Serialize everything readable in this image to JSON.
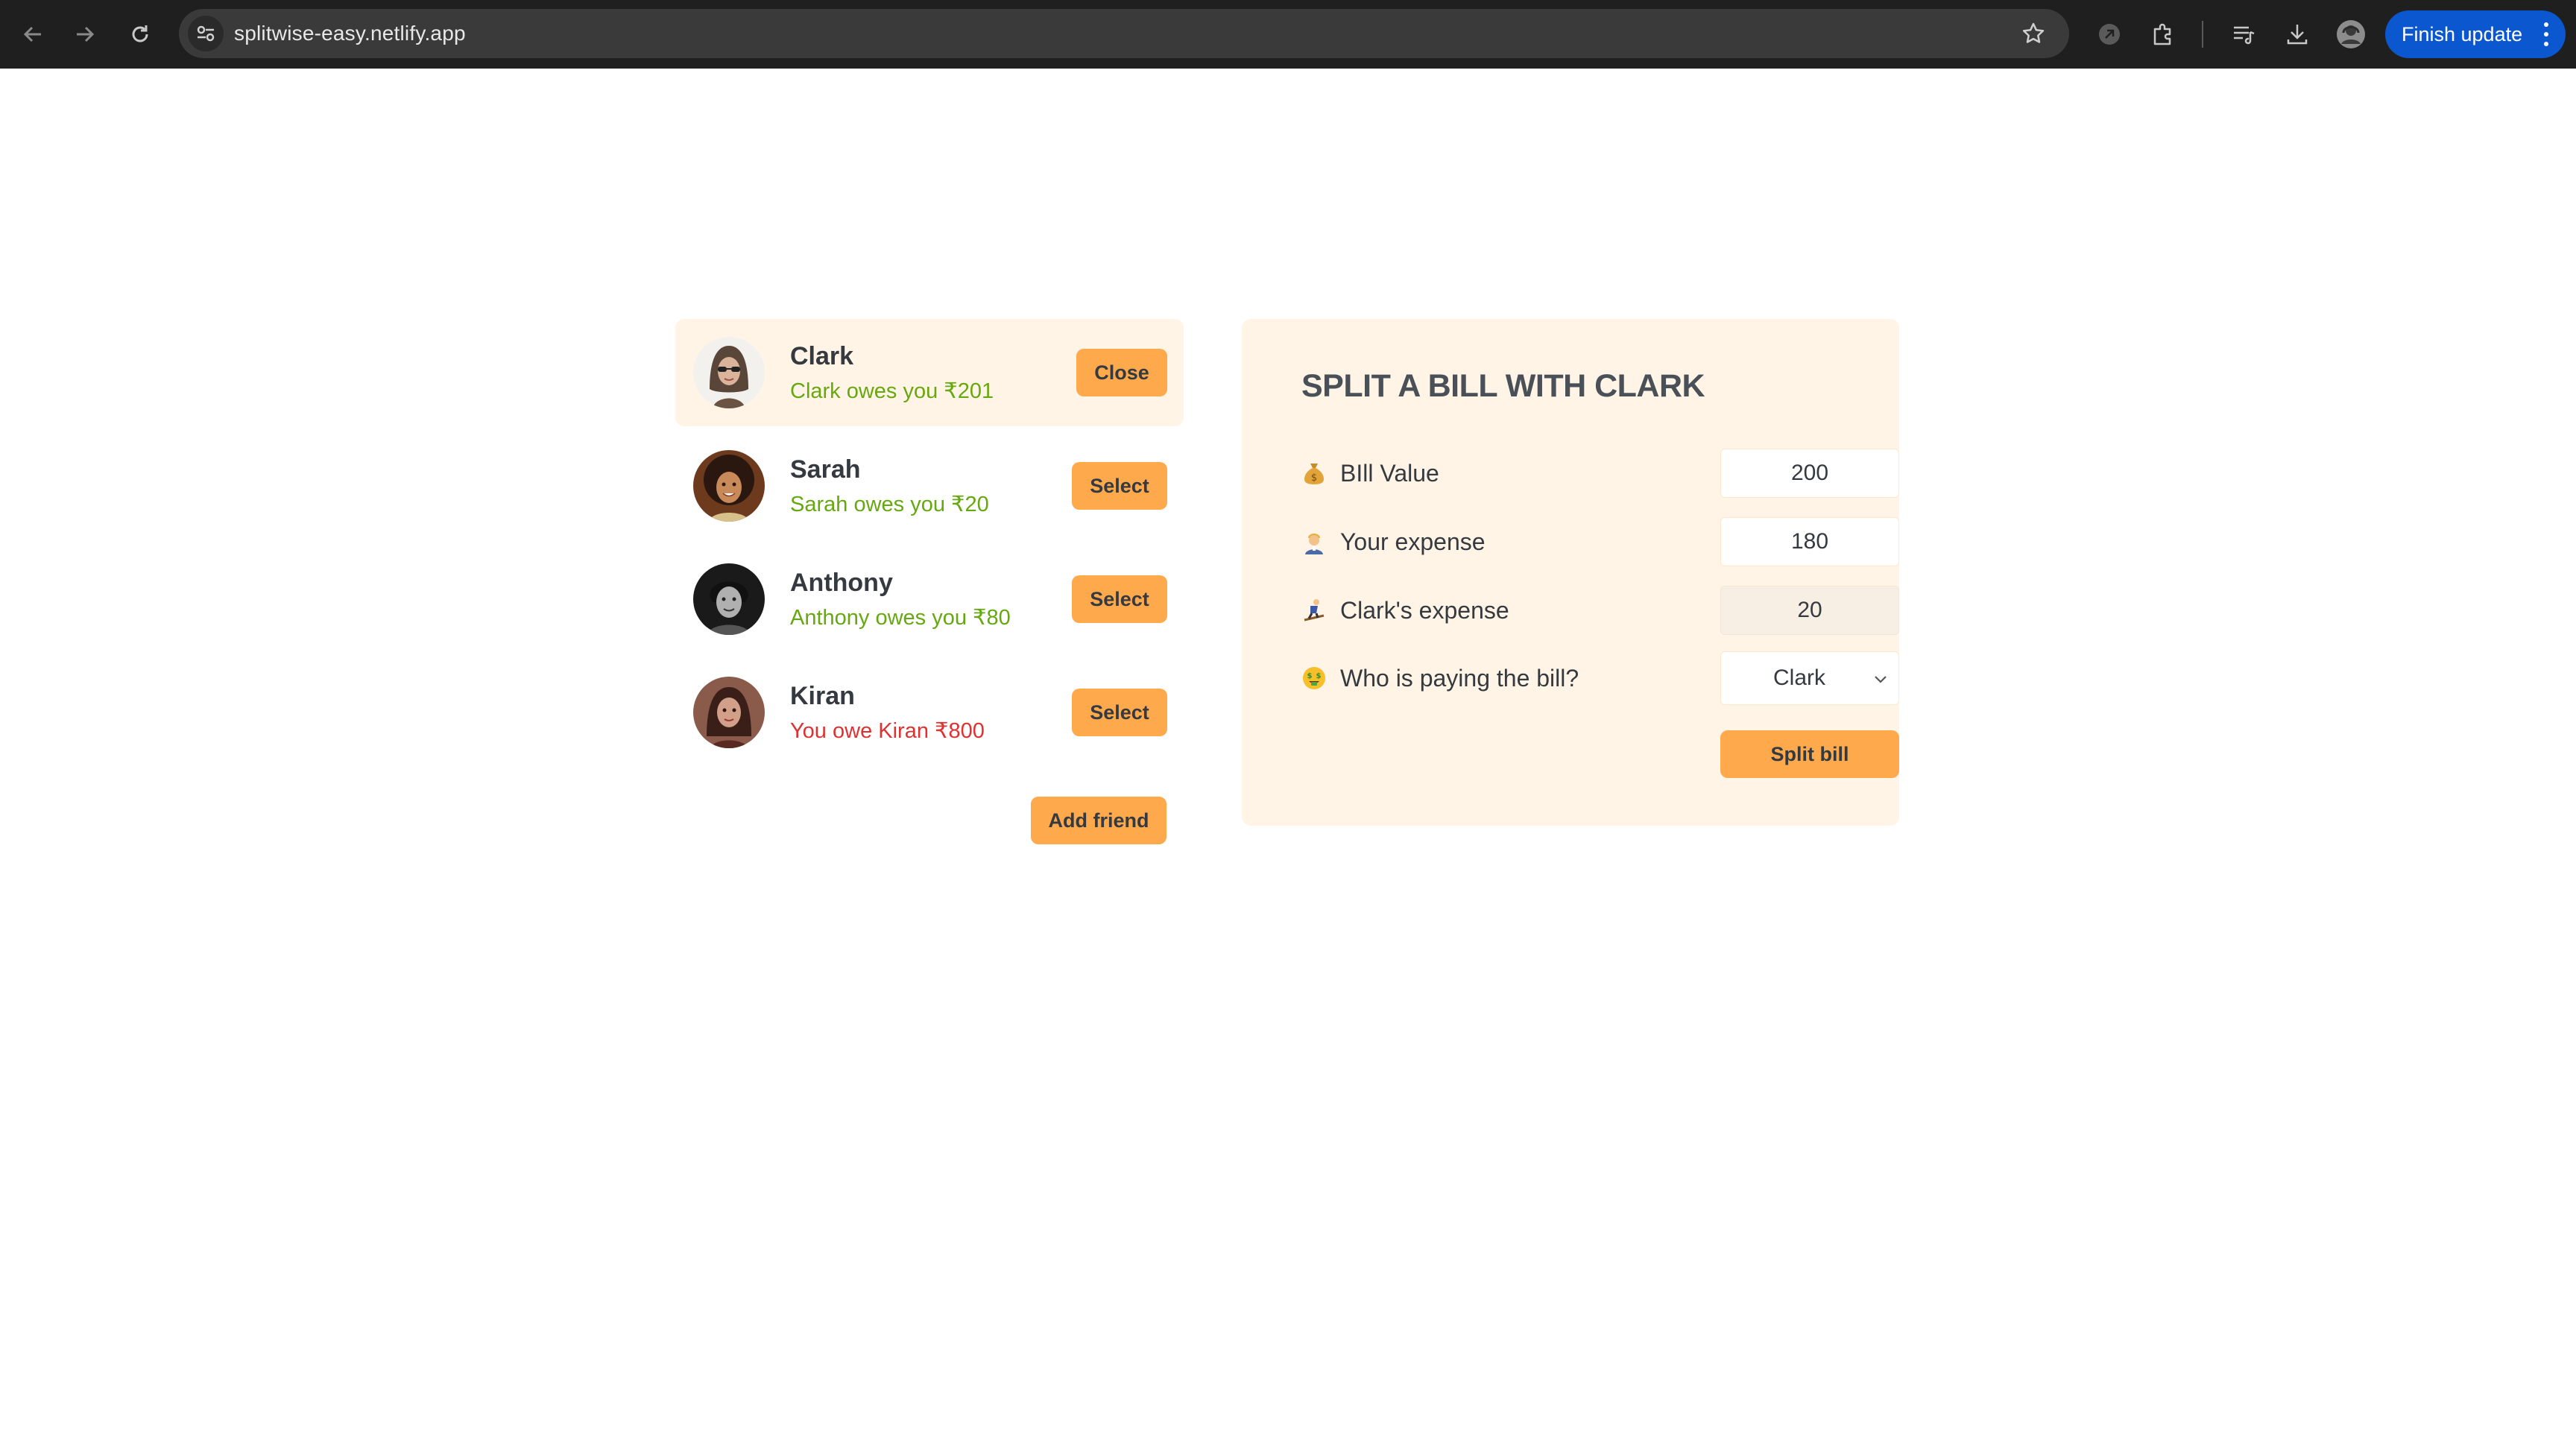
{
  "browser": {
    "url": "splitwise-easy.netlify.app",
    "update_label": "Finish update"
  },
  "friends": [
    {
      "name": "Clark",
      "balance": "Clark owes you ₹201",
      "status": "positive",
      "button": "Close",
      "selected": true
    },
    {
      "name": "Sarah",
      "balance": "Sarah owes you ₹20",
      "status": "positive",
      "button": "Select",
      "selected": false
    },
    {
      "name": "Anthony",
      "balance": "Anthony owes you ₹80",
      "status": "positive",
      "button": "Select",
      "selected": false
    },
    {
      "name": "Kiran",
      "balance": "You owe Kiran ₹800",
      "status": "negative",
      "button": "Select",
      "selected": false
    }
  ],
  "add_friend_label": "Add friend",
  "split": {
    "title": "SPLIT A BILL WITH CLARK",
    "bill_label": "BIll Value",
    "bill_value": "200",
    "your_expense_label": "Your expense",
    "your_expense_value": "180",
    "friend_expense_label": "Clark's expense",
    "friend_expense_value": "20",
    "payer_label": "Who is paying the bill?",
    "payer_value": "Clark",
    "submit_label": "Split bill"
  },
  "colors": {
    "accent": "#ffa94d",
    "panel_bg": "#fff4e6",
    "positive": "#66a80f",
    "negative": "#e03131",
    "chrome_bg": "#1f1f1f",
    "update_btn": "#0b57d0"
  }
}
